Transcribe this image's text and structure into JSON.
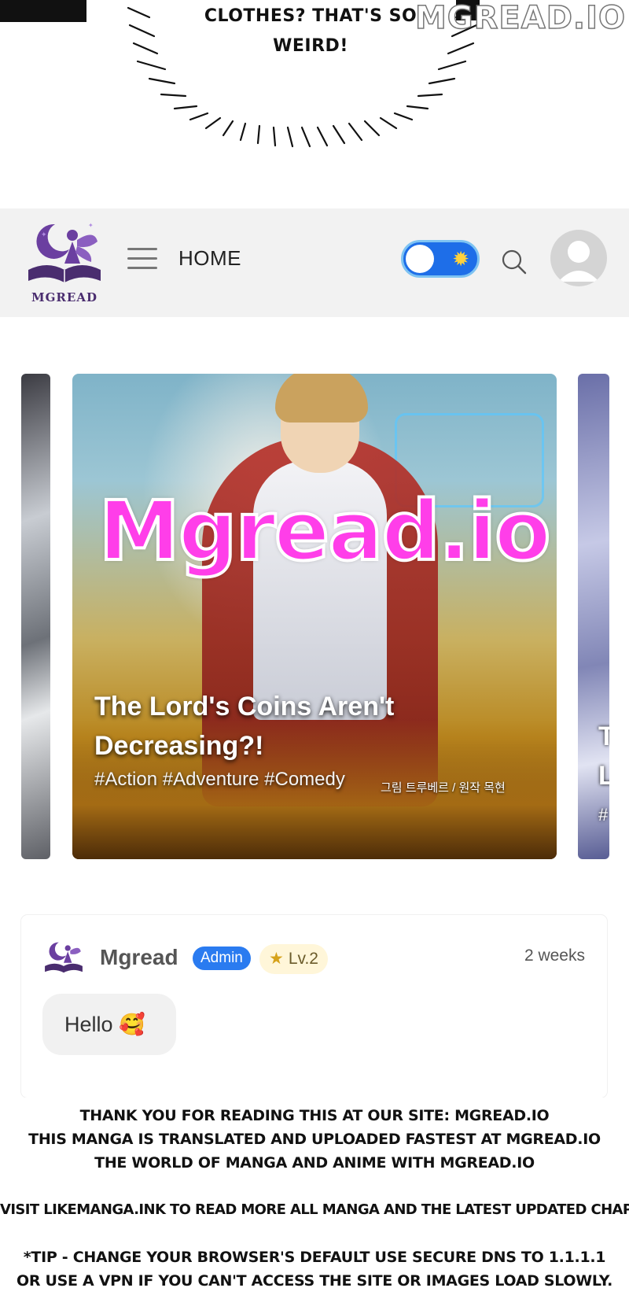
{
  "top_panel": {
    "speech_line_1": "CLOTHES? THAT'S SO",
    "speech_line_2": "WEIRD!",
    "watermark": "MGREAD.IO"
  },
  "header": {
    "logo_text": "MGREAD",
    "nav_label": "HOME",
    "theme_toggle": {
      "state": "on",
      "icon": "sun-icon"
    },
    "search_icon": "search-icon",
    "avatar_icon": "user-avatar-icon"
  },
  "carousel": {
    "main_card": {
      "title_line_1": "The Lord's Coins Aren't",
      "title_line_2": "Decreasing?!",
      "tags": "#Action #Adventure #Comedy",
      "credit": "그림 트루베르 / 원작 목현"
    },
    "right_card_fragments": [
      "T",
      "L",
      "#"
    ],
    "overlay_watermark": "Mgread.io"
  },
  "comment": {
    "username": "Mgread",
    "role_badge": "Admin",
    "level_badge": "Lv.2",
    "time": "2 weeks",
    "text": "Hello 🥰"
  },
  "footer": {
    "lines": [
      "THANK YOU FOR READING THIS AT OUR SITE: MGREAD.IO",
      "THIS MANGA IS TRANSLATED AND UPLOADED FASTEST AT MGREAD.IO",
      "THE WORLD OF MANGA AND ANIME WITH MGREAD.IO",
      "VISIT LIKEMANGA.INK TO READ MORE ALL MANGA AND THE LATEST UPDATED CHAPTERS.",
      "*TIP - CHANGE YOUR BROWSER'S DEFAULT USE SECURE DNS TO 1.1.1.1",
      "OR USE A VPN IF YOU CAN'T ACCESS THE SITE OR IMAGES LOAD SLOWLY."
    ]
  },
  "colors": {
    "header_bg": "#f2f2f2",
    "toggle_bg": "#1e6ee8",
    "admin_badge": "#2a7bf0",
    "watermark_pink": "#ff3ee9",
    "logo_purple": "#4a2d6f"
  }
}
